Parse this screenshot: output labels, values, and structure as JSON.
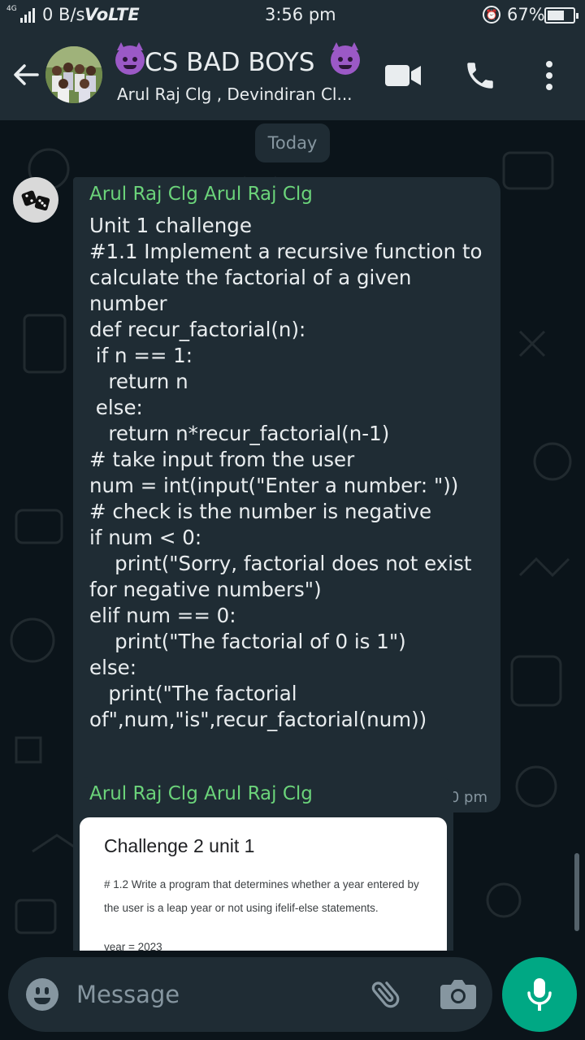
{
  "status_bar": {
    "network_tag": "4G",
    "data_rate": "0 B/s",
    "volte": "VoLTE",
    "time": "3:56 pm",
    "battery_percent": "67%",
    "battery_level": 0.67
  },
  "header": {
    "group_name": "CS BAD BOYS",
    "members_preview": "Arul Raj Clg , Devindiran Cl..."
  },
  "chat": {
    "date_chip": "Today",
    "messages": [
      {
        "sender": "Arul Raj Clg Arul Raj Clg",
        "text": "Unit 1 challenge\n#1.1 Implement a recursive function to calculate the factorial of a given number\ndef recur_factorial(n):\n if n == 1:\n   return n\n else:\n   return n*recur_factorial(n-1)\n# take input from the user\nnum = int(input(\"Enter a number: \"))\n# check is the number is negative\nif num < 0:\n    print(\"Sorry, factorial does not exist for negative numbers\")\nelif num == 0:\n    print(\"The factorial of 0 is 1\")\nelse:\n   print(\"The factorial of\",num,\"is\",recur_factorial(num))",
        "time": "3:10 pm"
      },
      {
        "sender": "Arul Raj Clg Arul Raj Clg",
        "image_title": "Challenge 2 unit 1",
        "image_body": "# 1.2 Write a program that determines whether a year entered by the user is a leap year or not using ifelif-else statements.",
        "image_cut_text": "year = 2023"
      }
    ]
  },
  "composer": {
    "placeholder": "Message"
  },
  "icons": {
    "back": "arrow-left-icon",
    "video": "video-camera-icon",
    "call": "phone-icon",
    "menu": "more-vertical-icon",
    "emoji": "emoji-icon",
    "attach": "paperclip-icon",
    "camera": "camera-icon",
    "mic": "microphone-icon"
  },
  "colors": {
    "background": "#0b141a",
    "bar": "#1f2c34",
    "bubble": "#1f2c34",
    "sender_name": "#6bd37a",
    "accent": "#00a884",
    "text": "#e9edef",
    "muted": "#8696a0"
  }
}
